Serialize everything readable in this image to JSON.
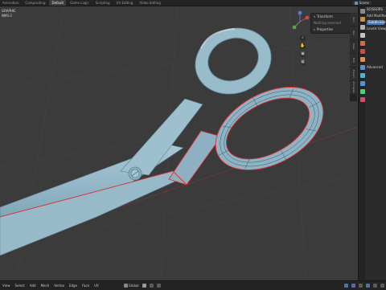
{
  "topbar": {
    "tabs": [
      "Animation",
      "Compositing",
      "Default",
      "Game Logic",
      "Scripting",
      "UV Editing",
      "Video Editing"
    ],
    "active_tab": "Default",
    "scene_label": "Scene"
  },
  "viewport": {
    "overlay_lines": [
      "GRAPHIC",
      "NMS-2"
    ]
  },
  "npanel": {
    "transform": "Transform",
    "nothing_selected": "Nothing selected",
    "properties": "Properties",
    "tabs": [
      "Item",
      "Tool",
      "View",
      "Edit",
      "Export",
      "Animation",
      "Scripting"
    ]
  },
  "props": {
    "object": "SCISSORS",
    "modifier": "Add Modifier",
    "sub": "Subdivision",
    "levels": "Levels Viewport",
    "adv": "Advanced"
  },
  "statusbar": {
    "menus": [
      "View",
      "Select",
      "Add",
      "Mesh",
      "Vertex",
      "Edge",
      "Face",
      "UV"
    ],
    "orientation": "Global"
  },
  "colors": {
    "mesh": "#8fb3c4",
    "mesh_shadow": "#5f8597",
    "mesh_highlight": "#d6e8ef",
    "selected_edge": "#e32b2b",
    "wire": "#2d4a58",
    "grid_line": "#4a4a4a"
  }
}
